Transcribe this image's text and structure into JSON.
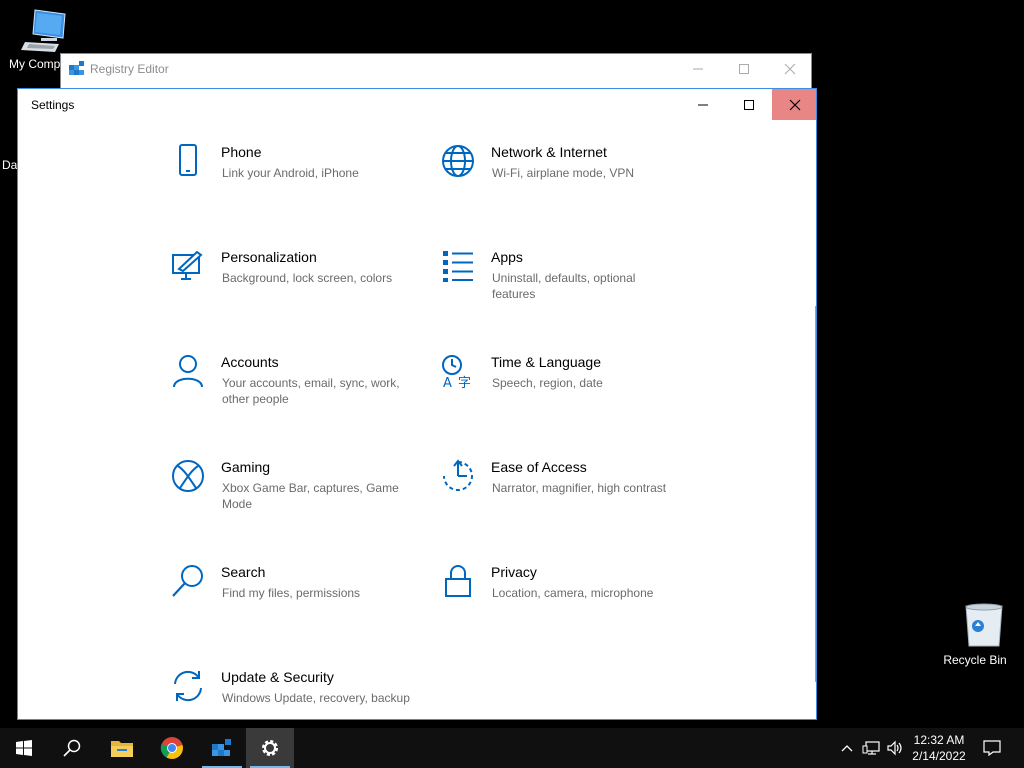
{
  "desktop": {
    "icons": [
      {
        "label": "My Computer",
        "visible_label": "My Compu"
      },
      {
        "label": "Recycle Bin"
      }
    ],
    "partial_label": "Da"
  },
  "regedit": {
    "title": "Registry Editor"
  },
  "settings": {
    "title": "Settings",
    "accent": "#0067c0",
    "tiles": [
      {
        "name": "Phone",
        "desc": "Link your Android, iPhone",
        "icon": "phone-icon"
      },
      {
        "name": "Network & Internet",
        "desc": "Wi-Fi, airplane mode, VPN",
        "icon": "globe-icon"
      },
      {
        "name": "Personalization",
        "desc": "Background, lock screen, colors",
        "icon": "paint-icon"
      },
      {
        "name": "Apps",
        "desc": "Uninstall, defaults, optional features",
        "icon": "apps-list-icon"
      },
      {
        "name": "Accounts",
        "desc": "Your accounts, email, sync, work, other people",
        "icon": "person-icon"
      },
      {
        "name": "Time & Language",
        "desc": "Speech, region, date",
        "icon": "time-language-icon"
      },
      {
        "name": "Gaming",
        "desc": "Xbox Game Bar, captures, Game Mode",
        "icon": "xbox-icon"
      },
      {
        "name": "Ease of Access",
        "desc": "Narrator, magnifier, high contrast",
        "icon": "ease-of-access-icon"
      },
      {
        "name": "Search",
        "desc": "Find my files, permissions",
        "icon": "search-icon"
      },
      {
        "name": "Privacy",
        "desc": "Location, camera, microphone",
        "icon": "lock-icon"
      },
      {
        "name": "Update & Security",
        "desc": "Windows Update, recovery, backup",
        "icon": "sync-icon"
      }
    ]
  },
  "taskbar": {
    "apps": [
      "start-icon",
      "search-icon",
      "file-explorer-icon",
      "chrome-icon",
      "registry-editor-icon",
      "settings-gear-icon"
    ],
    "clock": {
      "time": "12:32 AM",
      "date": "2/14/2022"
    }
  }
}
